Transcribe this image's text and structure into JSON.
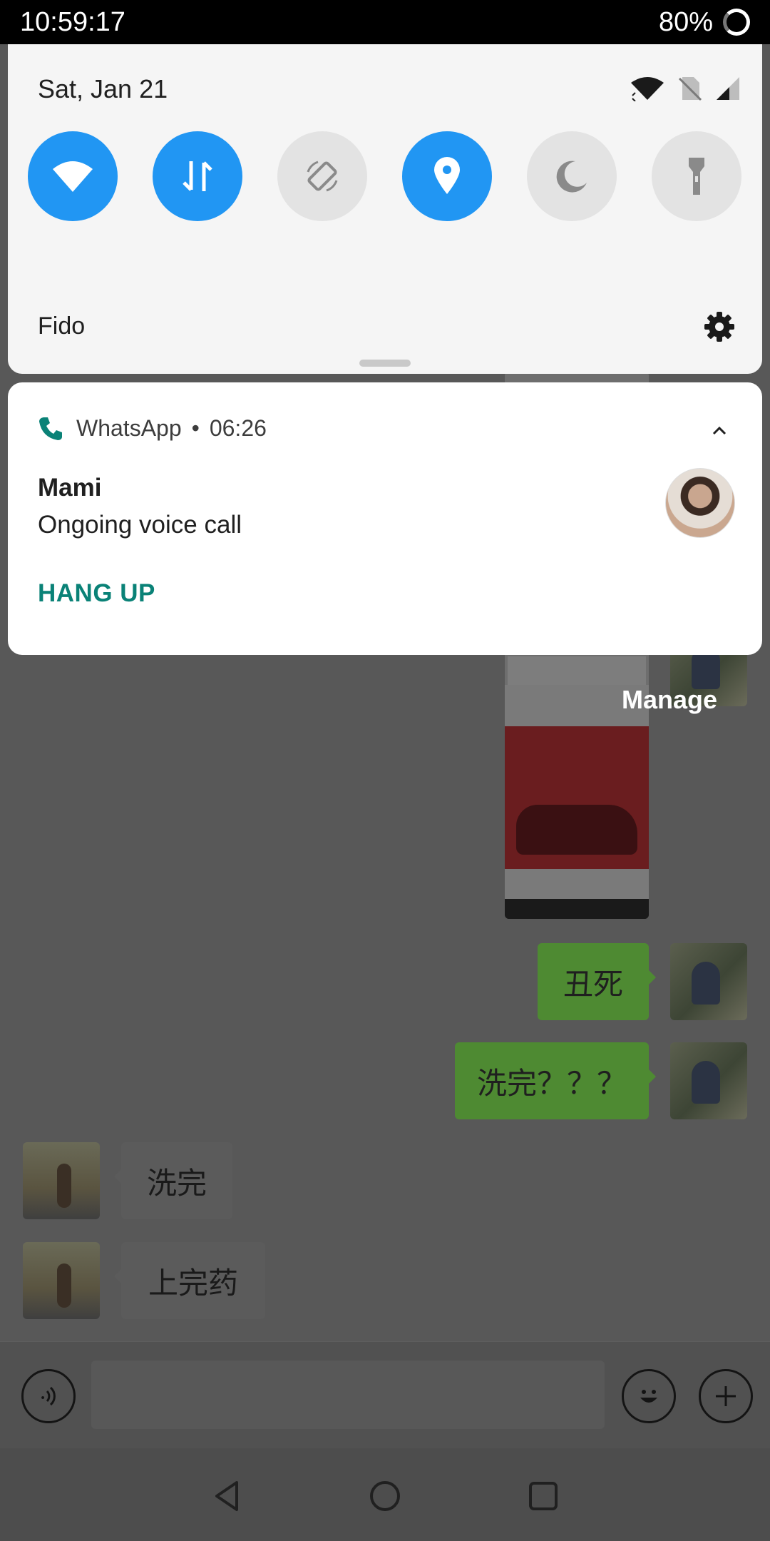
{
  "status_bar": {
    "time": "10:59:17",
    "battery": "80%"
  },
  "quick_settings": {
    "date": "Sat, Jan 21",
    "carrier": "Fido",
    "tiles": [
      {
        "name": "wifi",
        "state": "on"
      },
      {
        "name": "mobile-data",
        "state": "on"
      },
      {
        "name": "auto-rotate",
        "state": "off"
      },
      {
        "name": "location",
        "state": "on"
      },
      {
        "name": "night-mode",
        "state": "off"
      },
      {
        "name": "flashlight",
        "state": "off"
      }
    ],
    "accent_color": "#2196f3"
  },
  "notification": {
    "app": "WhatsApp",
    "time": "06:26",
    "title": "Mami",
    "text": "Ongoing voice call",
    "action": "HANG UP",
    "action_color": "#0a8277"
  },
  "chat": {
    "manage_label": "Manage",
    "messages": [
      {
        "side": "right",
        "text": "丑死"
      },
      {
        "side": "right",
        "text": "洗完？？？"
      },
      {
        "side": "left",
        "text": "洗完"
      },
      {
        "side": "left",
        "text": "上完药"
      }
    ]
  }
}
